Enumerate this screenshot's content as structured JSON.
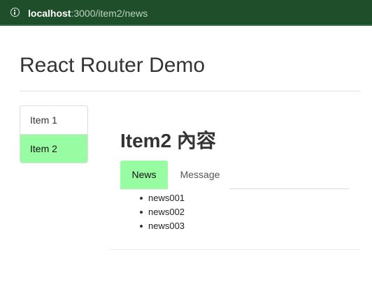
{
  "browser": {
    "url_host": "localhost",
    "url_path": ":3000/item2/news"
  },
  "header": {
    "title": "React Router Demo"
  },
  "sidebar": {
    "items": [
      {
        "label": "Item 1",
        "active": false
      },
      {
        "label": "Item 2",
        "active": true
      }
    ]
  },
  "main": {
    "title": "Item2 內容",
    "tabs": [
      {
        "label": "News",
        "active": true
      },
      {
        "label": "Message",
        "active": false
      }
    ],
    "news": [
      "news001",
      "news002",
      "news003"
    ]
  },
  "colors": {
    "active_bg": "#98fda2",
    "browser_bar": "#1f4e2a"
  }
}
